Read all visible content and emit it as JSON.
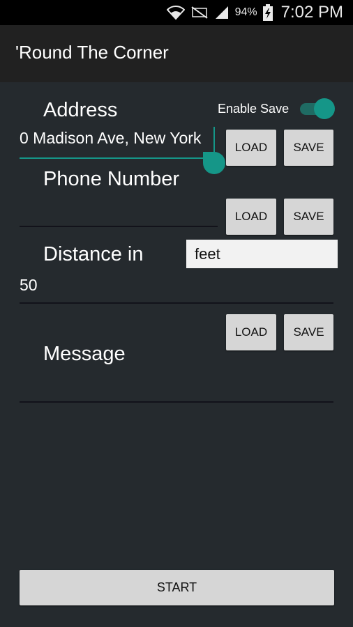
{
  "status_bar": {
    "battery_percent": "94%",
    "time": "7:02 PM",
    "icons": [
      "wifi-icon",
      "no-sim-icon",
      "signal-icon",
      "battery-charging-icon"
    ]
  },
  "app": {
    "title": "'Round The Corner"
  },
  "colors": {
    "accent": "#159688",
    "background": "#252a2e",
    "action_bar": "#212121",
    "button": "#d6d6d6"
  },
  "form": {
    "address": {
      "label": "Address",
      "value": "0 Madison Ave, New York",
      "enable_save_label": "Enable Save",
      "enable_save_on": true,
      "load_label": "LOAD",
      "save_label": "SAVE"
    },
    "phone": {
      "label": "Phone Number",
      "value": "",
      "load_label": "LOAD",
      "save_label": "SAVE"
    },
    "distance": {
      "label": "Distance in",
      "value": "50",
      "unit_selected": "feet"
    },
    "message": {
      "label": "Message",
      "value": "",
      "load_label": "LOAD",
      "save_label": "SAVE"
    }
  },
  "start_label": "START"
}
